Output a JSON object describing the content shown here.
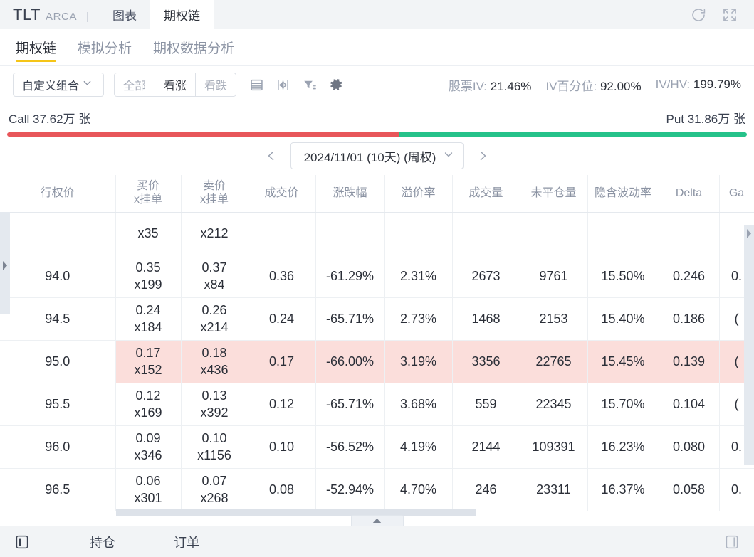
{
  "window": {
    "ticker": "TLT",
    "exchange": "ARCA",
    "divider": "|",
    "tabs": [
      {
        "label": "图表",
        "active": false
      },
      {
        "label": "期权链",
        "active": true
      }
    ],
    "refresh_icon": "refresh-icon",
    "fullscreen_icon": "fullscreen-icon"
  },
  "subtabs": [
    {
      "label": "期权链",
      "active": true
    },
    {
      "label": "模拟分析",
      "active": false
    },
    {
      "label": "期权数据分析",
      "active": false
    }
  ],
  "toolbar": {
    "strategy_select": "自定义组合",
    "filters": [
      {
        "label": "全部",
        "active": false
      },
      {
        "label": "看涨",
        "active": true
      },
      {
        "label": "看跌",
        "active": false
      }
    ],
    "icons": [
      {
        "name": "layout-rows-icon"
      },
      {
        "name": "mirror-columns-icon"
      },
      {
        "name": "filter-icon"
      },
      {
        "name": "gear-icon"
      }
    ],
    "stats": [
      {
        "label": "股票IV:",
        "value": "21.46%"
      },
      {
        "label": "IV百分位:",
        "value": "92.00%"
      },
      {
        "label": "IV/HV:",
        "value": "199.79%"
      }
    ]
  },
  "volume_bar": {
    "call_label": "Call 37.62万 张",
    "put_label": "Put 31.86万 张",
    "call_pct": 53,
    "put_pct": 47,
    "call_color": "#e8565a",
    "put_color": "#25c28a"
  },
  "expiry": {
    "prev_icon": "chevron-left-icon",
    "next_icon": "chevron-right-icon",
    "value": "2024/11/01 (10天) (周权)",
    "dropdown_icon": "chevron-down-icon"
  },
  "table": {
    "columns": [
      {
        "label": "行权价",
        "sub": ""
      },
      {
        "label": "买价",
        "sub": "x挂单"
      },
      {
        "label": "卖价",
        "sub": "x挂单"
      },
      {
        "label": "成交价",
        "sub": ""
      },
      {
        "label": "涨跌幅",
        "sub": ""
      },
      {
        "label": "溢价率",
        "sub": ""
      },
      {
        "label": "成交量",
        "sub": ""
      },
      {
        "label": "未平仓量",
        "sub": ""
      },
      {
        "label": "隐含波动率",
        "sub": ""
      },
      {
        "label": "Delta",
        "sub": ""
      },
      {
        "label": "Ga",
        "sub": ""
      }
    ],
    "rows": [
      {
        "partial": true,
        "highlighted": false,
        "strike": "",
        "bid": "",
        "bid_size": "x35",
        "ask": "",
        "ask_size": "x212",
        "last": "",
        "change": "",
        "change_dir": "down",
        "premium": "",
        "volume": "",
        "open_interest": "",
        "iv": "",
        "delta": "",
        "gamma": ""
      },
      {
        "partial": false,
        "highlighted": false,
        "strike": "94.0",
        "bid": "0.35",
        "bid_size": "x199",
        "ask": "0.37",
        "ask_size": "x84",
        "last": "0.36",
        "change": "-61.29%",
        "change_dir": "down",
        "premium": "2.31%",
        "volume": "2673",
        "open_interest": "9761",
        "iv": "15.50%",
        "delta": "0.246",
        "gamma": "0."
      },
      {
        "partial": false,
        "highlighted": false,
        "strike": "94.5",
        "bid": "0.24",
        "bid_size": "x184",
        "ask": "0.26",
        "ask_size": "x214",
        "last": "0.24",
        "change": "-65.71%",
        "change_dir": "down",
        "premium": "2.73%",
        "volume": "1468",
        "open_interest": "2153",
        "iv": "15.40%",
        "delta": "0.186",
        "gamma": "("
      },
      {
        "partial": false,
        "highlighted": true,
        "strike": "95.0",
        "bid": "0.17",
        "bid_size": "x152",
        "ask": "0.18",
        "ask_size": "x436",
        "last": "0.17",
        "change": "-66.00%",
        "change_dir": "down",
        "premium": "3.19%",
        "volume": "3356",
        "open_interest": "22765",
        "iv": "15.45%",
        "delta": "0.139",
        "gamma": "("
      },
      {
        "partial": false,
        "highlighted": false,
        "strike": "95.5",
        "bid": "0.12",
        "bid_size": "x169",
        "ask": "0.13",
        "ask_size": "x392",
        "last": "0.12",
        "change": "-65.71%",
        "change_dir": "down",
        "premium": "3.68%",
        "volume": "559",
        "open_interest": "22345",
        "iv": "15.70%",
        "delta": "0.104",
        "gamma": "("
      },
      {
        "partial": false,
        "highlighted": false,
        "strike": "96.0",
        "bid": "0.09",
        "bid_size": "x346",
        "ask": "0.10",
        "ask_size": "x1156",
        "last": "0.10",
        "change": "-56.52%",
        "change_dir": "down",
        "premium": "4.19%",
        "volume": "2144",
        "open_interest": "109391",
        "iv": "16.23%",
        "delta": "0.080",
        "gamma": "0."
      },
      {
        "partial": false,
        "highlighted": false,
        "strike": "96.5",
        "bid": "0.06",
        "bid_size": "x301",
        "ask": "0.07",
        "ask_size": "x268",
        "last": "0.08",
        "change": "-52.94%",
        "change_dir": "down",
        "premium": "4.70%",
        "volume": "246",
        "open_interest": "23311",
        "iv": "16.37%",
        "delta": "0.058",
        "gamma": "0."
      }
    ]
  },
  "footer": {
    "panel_icon": "panel-left-icon",
    "positions": "持仓",
    "orders": "订单",
    "right_icon": "panel-right-icon"
  },
  "colors": {
    "accent": "#f5c518",
    "down": "#25c28a",
    "up": "#e8565a",
    "highlight_row": "#fbdedb",
    "chrome": "#f2f4f6"
  }
}
